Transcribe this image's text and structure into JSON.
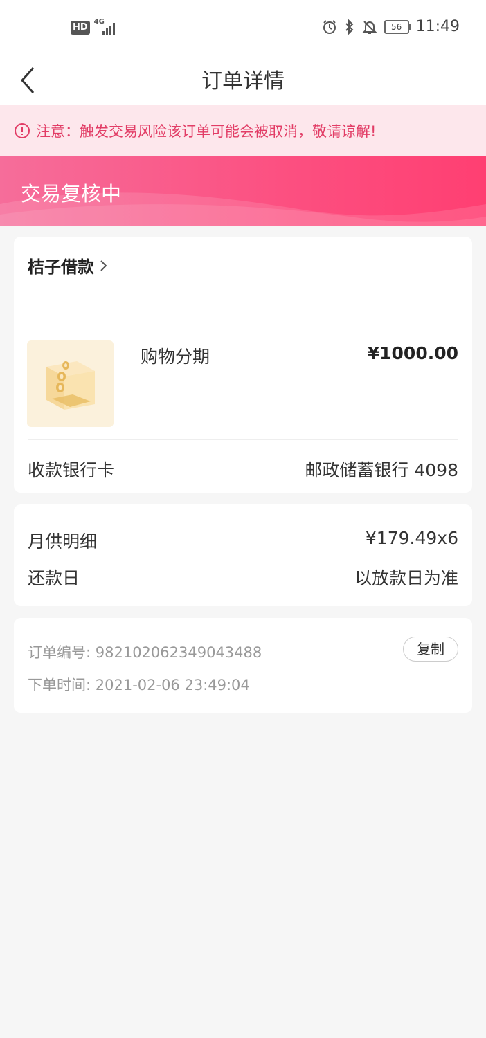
{
  "status_bar": {
    "hd": "HD",
    "network": "4G",
    "battery": "56",
    "time": "11:49"
  },
  "nav": {
    "title": "订单详情"
  },
  "notice": {
    "text": "注意：触发交易风险该订单可能会被取消，敬请谅解!"
  },
  "banner": {
    "status": "交易复核中"
  },
  "order": {
    "merchant": "桔子借款",
    "product_name": "购物分期",
    "price": "¥1000.00",
    "bank_label": "收款银行卡",
    "bank_value": "邮政储蓄银行 4098"
  },
  "repayment": {
    "monthly_label": "月供明细",
    "monthly_value": "¥179.49x6",
    "due_label": "还款日",
    "due_value": "以放款日为准"
  },
  "info": {
    "order_no": "订单编号: 982102062349043488",
    "order_time": "下单时间: 2021-02-06 23:49:04",
    "copy_label": "复制"
  },
  "colors": {
    "accent": "#ff3f72",
    "notice_text": "#e23d66",
    "notice_bg": "#fde7ec"
  }
}
